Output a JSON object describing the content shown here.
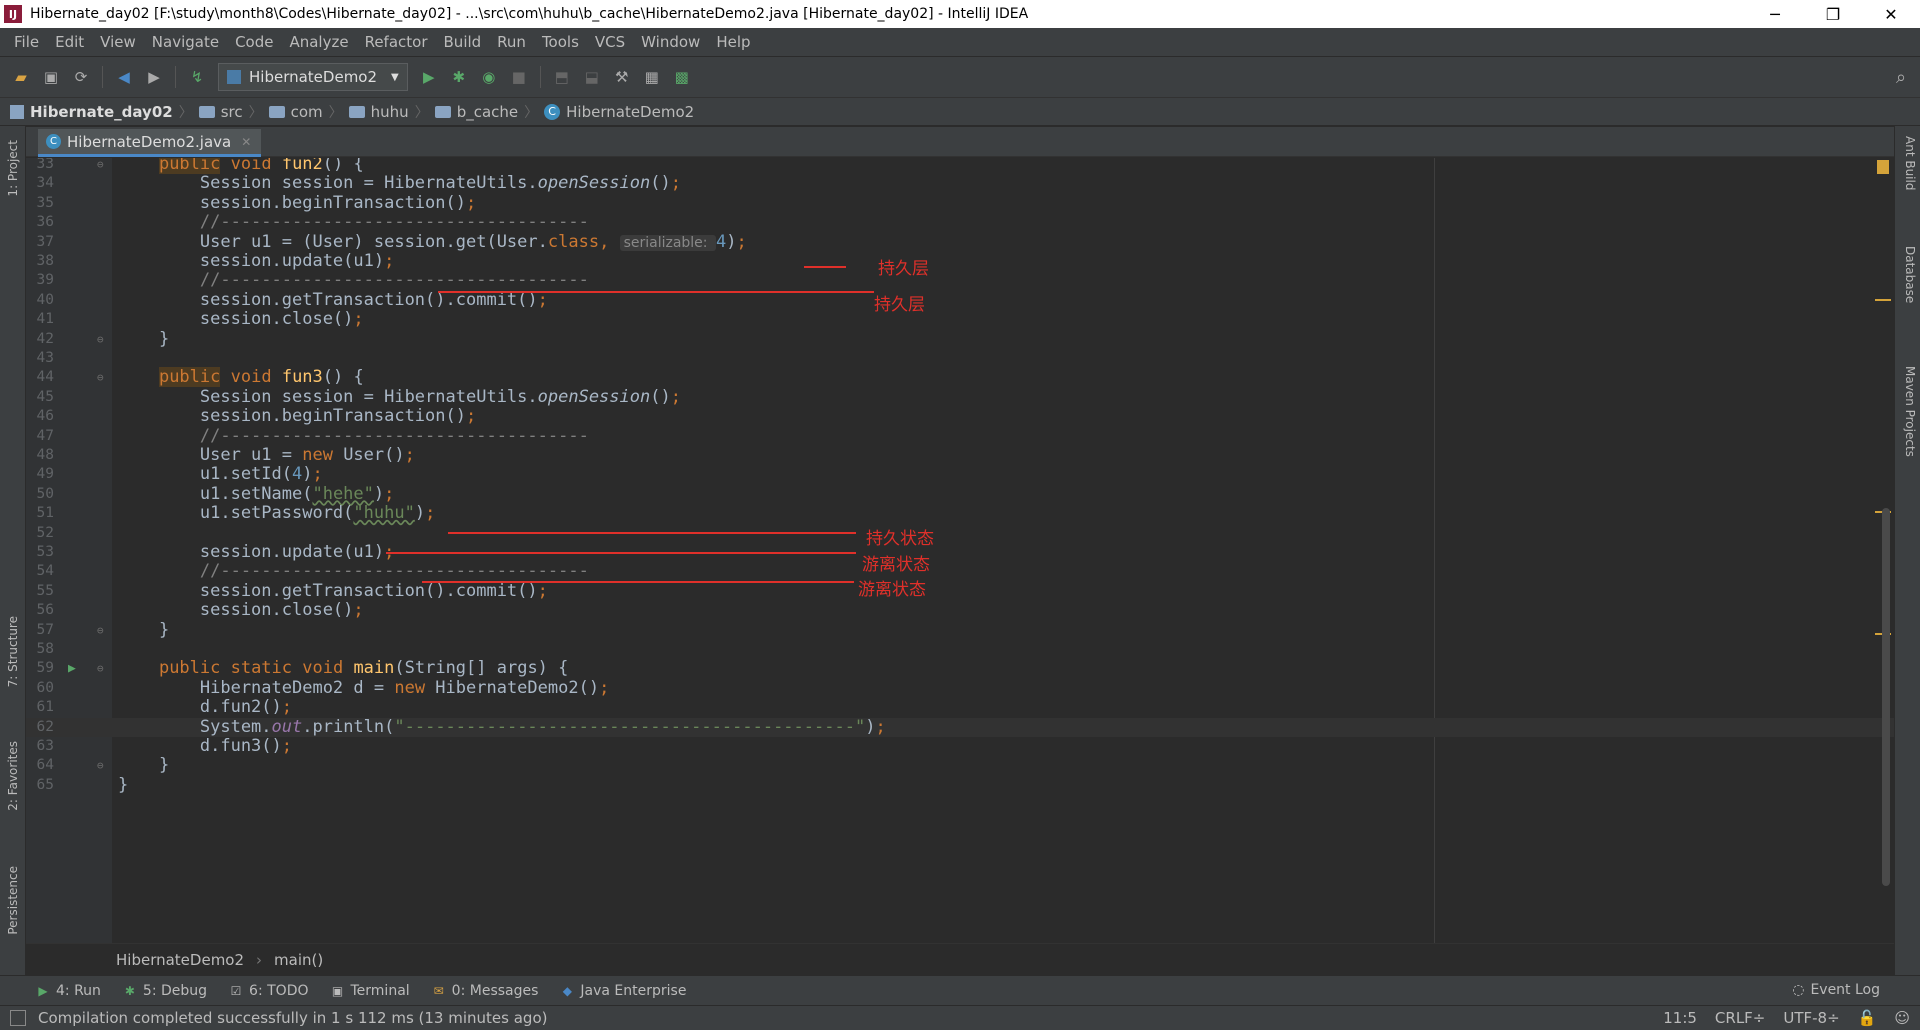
{
  "window": {
    "title": "Hibernate_day02 [F:\\study\\month8\\Codes\\Hibernate_day02] - ...\\src\\com\\huhu\\b_cache\\HibernateDemo2.java [Hibernate_day02] - IntelliJ IDEA",
    "app_icon": "IJ",
    "minimize": "─",
    "restore": "❐",
    "close": "✕"
  },
  "menu": [
    "File",
    "Edit",
    "View",
    "Navigate",
    "Code",
    "Analyze",
    "Refactor",
    "Build",
    "Run",
    "Tools",
    "VCS",
    "Window",
    "Help"
  ],
  "toolbar": {
    "run_config": "HibernateDemo2",
    "icons": [
      "open-icon",
      "save-icon",
      "sync-icon",
      "back-icon",
      "forward-icon",
      "build-icon",
      "run-icon",
      "debug-icon",
      "coverage-icon",
      "stop-icon",
      "search-icon"
    ]
  },
  "breadcrumbs": [
    "Hibernate_day02",
    "src",
    "com",
    "huhu",
    "b_cache",
    "HibernateDemo2"
  ],
  "left_tabs": [
    "1: Project",
    "7: Structure",
    "2: Favorites",
    "Persistence"
  ],
  "right_tabs": [
    "Ant Build",
    "Database",
    "Maven Projects"
  ],
  "editor": {
    "tab": "HibernateDemo2.java",
    "hint_label": "serializable:",
    "lines": [
      {
        "no": "33",
        "fold": "⊖",
        "tokens": [
          [
            "",
            "    "
          ],
          [
            "kwhl",
            "public"
          ],
          [
            "",
            " "
          ],
          [
            "kw",
            "void"
          ],
          [
            "",
            " "
          ],
          [
            "fn",
            "fun2"
          ],
          [
            "",
            "() {"
          ]
        ]
      },
      {
        "no": "34",
        "tokens": [
          [
            "",
            "        Session session = HibernateUtils."
          ],
          [
            "it",
            "openSession"
          ],
          [
            "",
            "()"
          ],
          [
            "kw",
            ";"
          ]
        ]
      },
      {
        "no": "35",
        "tokens": [
          [
            "",
            "        session.beginTransaction()"
          ],
          [
            "kw",
            ";"
          ]
        ]
      },
      {
        "no": "36",
        "tokens": [
          [
            "cm",
            "        //------------------------------------"
          ]
        ]
      },
      {
        "no": "37",
        "tokens": [
          [
            "",
            "        User u1 = (User) session.get(User."
          ],
          [
            "kw",
            "class"
          ],
          [
            "kw",
            ","
          ],
          [
            "",
            " "
          ],
          [
            "hint",
            "serializable: "
          ],
          [
            "num",
            "4"
          ],
          [
            "",
            ")"
          ],
          [
            "kw",
            ";"
          ]
        ]
      },
      {
        "no": "38",
        "tokens": [
          [
            "",
            "        session.update(u1)"
          ],
          [
            "kw",
            ";"
          ]
        ]
      },
      {
        "no": "39",
        "tokens": [
          [
            "cm",
            "        //------------------------------------"
          ]
        ]
      },
      {
        "no": "40",
        "tokens": [
          [
            "",
            "        session.getTransaction().commit()"
          ],
          [
            "kw",
            ";"
          ]
        ]
      },
      {
        "no": "41",
        "tokens": [
          [
            "",
            "        session.close()"
          ],
          [
            "kw",
            ";"
          ]
        ]
      },
      {
        "no": "42",
        "fold": "⊖",
        "tokens": [
          [
            "",
            "    }"
          ]
        ]
      },
      {
        "no": "43",
        "tokens": []
      },
      {
        "no": "44",
        "fold": "⊖",
        "tokens": [
          [
            "",
            "    "
          ],
          [
            "kwhl",
            "public"
          ],
          [
            "",
            " "
          ],
          [
            "kw",
            "void"
          ],
          [
            "",
            " "
          ],
          [
            "fn",
            "fun3"
          ],
          [
            "",
            "() {"
          ]
        ]
      },
      {
        "no": "45",
        "tokens": [
          [
            "",
            "        Session session = HibernateUtils."
          ],
          [
            "it",
            "openSession"
          ],
          [
            "",
            "()"
          ],
          [
            "kw",
            ";"
          ]
        ]
      },
      {
        "no": "46",
        "tokens": [
          [
            "",
            "        session.beginTransaction()"
          ],
          [
            "kw",
            ";"
          ]
        ]
      },
      {
        "no": "47",
        "tokens": [
          [
            "cm",
            "        //------------------------------------"
          ]
        ]
      },
      {
        "no": "48",
        "tokens": [
          [
            "",
            "        User u1 = "
          ],
          [
            "kw",
            "new"
          ],
          [
            "",
            " User()"
          ],
          [
            "kw",
            ";"
          ]
        ]
      },
      {
        "no": "49",
        "tokens": [
          [
            "",
            "        u1.setId("
          ],
          [
            "num",
            "4"
          ],
          [
            "",
            ")"
          ],
          [
            "kw",
            ";"
          ]
        ]
      },
      {
        "no": "50",
        "tokens": [
          [
            "",
            "        u1.setName("
          ],
          [
            "str uline",
            "\"hehe\""
          ],
          [
            "",
            ")"
          ],
          [
            "kw",
            ";"
          ]
        ]
      },
      {
        "no": "51",
        "tokens": [
          [
            "",
            "        u1.setPassword("
          ],
          [
            "str uline",
            "\"huhu\""
          ],
          [
            "",
            ")"
          ],
          [
            "kw",
            ";"
          ]
        ]
      },
      {
        "no": "52",
        "tokens": []
      },
      {
        "no": "53",
        "tokens": [
          [
            "",
            "        session.update(u1)"
          ],
          [
            "kw",
            ";"
          ]
        ]
      },
      {
        "no": "54",
        "tokens": [
          [
            "cm",
            "        //------------------------------------"
          ]
        ]
      },
      {
        "no": "55",
        "tokens": [
          [
            "",
            "        session.getTransaction().commit()"
          ],
          [
            "kw",
            ";"
          ]
        ]
      },
      {
        "no": "56",
        "tokens": [
          [
            "",
            "        session.close()"
          ],
          [
            "kw",
            ";"
          ]
        ]
      },
      {
        "no": "57",
        "fold": "⊖",
        "tokens": [
          [
            "",
            "    }"
          ]
        ]
      },
      {
        "no": "58",
        "tokens": []
      },
      {
        "no": "59",
        "run": "▶",
        "fold": "⊖",
        "tokens": [
          [
            "",
            "    "
          ],
          [
            "kw",
            "public static void"
          ],
          [
            "",
            " "
          ],
          [
            "fn",
            "main"
          ],
          [
            "",
            "(String[] args) {"
          ]
        ]
      },
      {
        "no": "60",
        "tokens": [
          [
            "",
            "        HibernateDemo2 d = "
          ],
          [
            "kw",
            "new"
          ],
          [
            "",
            " HibernateDemo2()"
          ],
          [
            "kw",
            ";"
          ]
        ]
      },
      {
        "no": "61",
        "tokens": [
          [
            "",
            "        d.fun2()"
          ],
          [
            "kw",
            ";"
          ]
        ]
      },
      {
        "no": "62",
        "current": true,
        "tokens": [
          [
            "",
            "        System."
          ],
          [
            "fld",
            "out"
          ],
          [
            "",
            ".println("
          ],
          [
            "str",
            "\"--------------------------------------------\""
          ],
          [
            "",
            ")"
          ],
          [
            "kw",
            ";"
          ]
        ]
      },
      {
        "no": "63",
        "tokens": [
          [
            "",
            "        d.fun3()"
          ],
          [
            "kw",
            ";"
          ]
        ]
      },
      {
        "no": "64",
        "fold": "⊖",
        "tokens": [
          [
            "",
            "    }"
          ]
        ]
      },
      {
        "no": "65",
        "tokens": [
          [
            "",
            "}"
          ]
        ]
      }
    ]
  },
  "annotations": [
    "持久层",
    "持久层",
    "持久状态",
    "游离状态",
    "游离状态"
  ],
  "method_breadcrumb": [
    "HibernateDemo2",
    "main()"
  ],
  "tool_windows": [
    {
      "label": "4: Run",
      "icon": "▶"
    },
    {
      "label": "5: Debug",
      "icon": "✱"
    },
    {
      "label": "6: TODO",
      "icon": "☑"
    },
    {
      "label": "Terminal",
      "icon": "▣"
    },
    {
      "label": "0: Messages",
      "icon": "✉"
    },
    {
      "label": "Java Enterprise",
      "icon": "◆"
    }
  ],
  "event_log": "Event Log",
  "status": {
    "message": "Compilation completed successfully in 1 s 112 ms (13 minutes ago)",
    "position": "11:5",
    "line_sep": "CRLF÷",
    "encoding": "UTF-8÷"
  },
  "colors": {
    "accent": "#4a88c7",
    "annotation": "#e0302a",
    "keyword": "#cc7832"
  }
}
